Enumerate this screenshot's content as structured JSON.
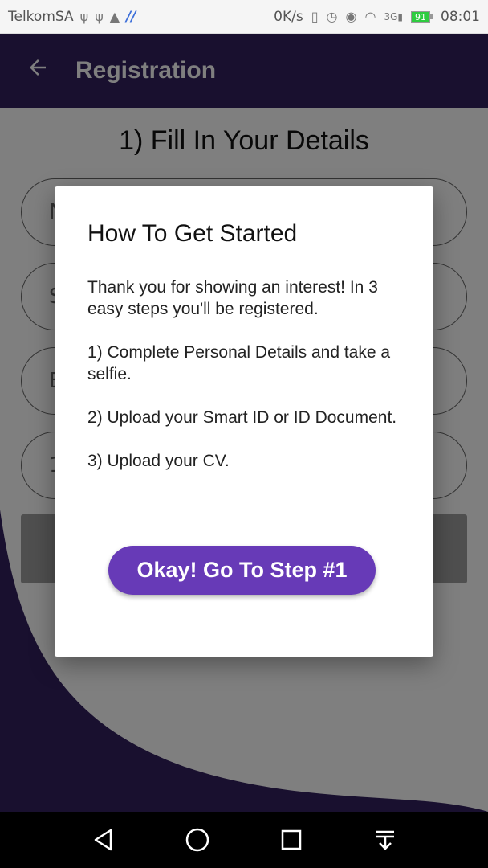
{
  "status_bar": {
    "carrier": "TelkomSA",
    "net_speed": "0K/s",
    "network": "3G",
    "battery": "91",
    "time": "08:01"
  },
  "app_bar": {
    "title": "Registration",
    "back_icon": "arrow-left-icon"
  },
  "page": {
    "step_title": "1) Fill In Your Details",
    "fields": [
      {
        "value": "N"
      },
      {
        "value": "S"
      },
      {
        "value": "E"
      },
      {
        "value": "1"
      }
    ]
  },
  "dialog": {
    "title": "How To Get Started",
    "paragraphs": [
      "Thank you for showing an interest! In 3 easy steps you'll be registered.",
      "1) Complete Personal Details and take a selfie.",
      "2) Upload your Smart ID or ID Document.",
      "3) Upload your CV."
    ],
    "button_label": "Okay! Go To Step #1"
  },
  "nav_bar": {
    "icons": [
      "back-triangle-icon",
      "home-circle-icon",
      "recents-square-icon",
      "notifications-pull-down-icon"
    ]
  },
  "colors": {
    "primary": "#33205e",
    "accent": "#673ab7",
    "scrim": "rgba(0,0,0,0.5)"
  }
}
